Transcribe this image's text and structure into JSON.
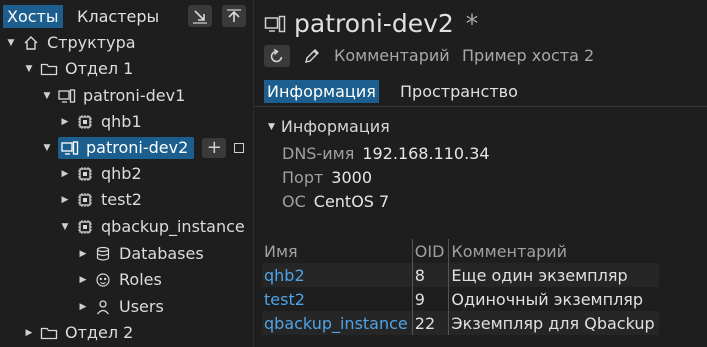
{
  "left_panel": {
    "tabs": [
      "Хосты",
      "Кластеры"
    ],
    "tree": {
      "root": "Структура",
      "dept1": "Отдел 1",
      "host1": "patroni-dev1",
      "host1_child": "qhb1",
      "host2": "patroni-dev2",
      "host2_children": [
        "qhb2",
        "test2",
        "qbackup_instance"
      ],
      "instance_children": [
        "Databases",
        "Roles",
        "Users"
      ],
      "dept2": "Отдел 2"
    }
  },
  "right_panel": {
    "title": "patroni-dev2",
    "title_star": "*",
    "comment_label": "Комментарий",
    "comment_value": "Пример хоста 2",
    "tabs": [
      "Информация",
      "Пространство"
    ],
    "section_title": "Информация",
    "info": [
      {
        "key": "DNS-имя",
        "value": "192.168.110.34"
      },
      {
        "key": "Порт",
        "value": "3000"
      },
      {
        "key": "ОС",
        "value": "CentOS 7"
      }
    ],
    "table": {
      "headers": [
        "Имя",
        "OID",
        "Комментарий"
      ],
      "rows": [
        [
          "qhb2",
          "8",
          "Еще один экземпляр"
        ],
        [
          "test2",
          "9",
          "Одиночный экземпляр"
        ],
        [
          "qbackup_instance",
          "22",
          "Экземпляр для Qbackup"
        ]
      ]
    }
  },
  "colors": {
    "accent": "#1c5f8e",
    "link": "#4fa3e6",
    "background": "#1e1e1e"
  }
}
